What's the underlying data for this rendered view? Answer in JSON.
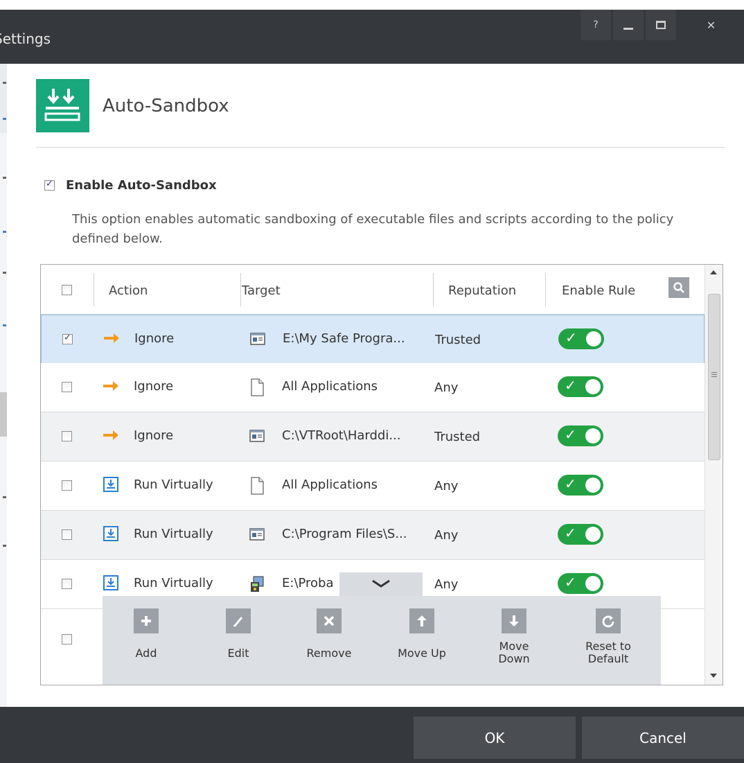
{
  "window": {
    "title": "Settings",
    "help_glyph": "?",
    "close_glyph": "✕"
  },
  "header": {
    "title": "Auto-Sandbox"
  },
  "enable": {
    "label": "Enable Auto-Sandbox",
    "checked": true,
    "description": "This option enables automatic sandboxing of executable files and scripts according to the policy defined below."
  },
  "table": {
    "columns": {
      "action": "Action",
      "target": "Target",
      "reputation": "Reputation",
      "enable_rule": "Enable Rule"
    },
    "rows": [
      {
        "action": "Ignore",
        "action_icon": "arrow-right-icon",
        "target": "E:\\My Safe Progra...",
        "target_icon": "program-window-icon",
        "reputation": "Trusted",
        "checked": true,
        "enabled": true
      },
      {
        "action": "Ignore",
        "action_icon": "arrow-right-icon",
        "target": "All Applications",
        "target_icon": "blank-file-icon",
        "reputation": "Any",
        "checked": false,
        "enabled": true
      },
      {
        "action": "Ignore",
        "action_icon": "arrow-right-icon",
        "target": "C:\\VTRoot\\Harddi...",
        "target_icon": "program-window-icon",
        "reputation": "Trusted",
        "checked": false,
        "enabled": true
      },
      {
        "action": "Run Virtually",
        "action_icon": "sandbox-download-icon",
        "target": "All Applications",
        "target_icon": "blank-file-icon",
        "reputation": "Any",
        "checked": false,
        "enabled": true
      },
      {
        "action": "Run Virtually",
        "action_icon": "sandbox-download-icon",
        "target": "C:\\Program Files\\S...",
        "target_icon": "program-window-icon",
        "reputation": "Any",
        "checked": false,
        "enabled": true
      },
      {
        "action": "Run Virtually",
        "action_icon": "sandbox-download-icon",
        "target": "E:\\Proba",
        "target_icon": "installer-icon",
        "reputation": "Any",
        "checked": false,
        "enabled": true
      }
    ]
  },
  "toolbar": {
    "add": "Add",
    "edit": "Edit",
    "remove": "Remove",
    "move_up": "Move Up",
    "move_down_1": "Move",
    "move_down_2": "Down",
    "reset_1": "Reset to",
    "reset_2": "Default"
  },
  "footer": {
    "ok": "OK",
    "cancel": "Cancel"
  },
  "colors": {
    "titlebar": "#35393e",
    "accent_green": "#19a77c",
    "toggle_on": "#23a244",
    "ignore_arrow": "#f39a1e",
    "selected_row": "#d8e8f8"
  }
}
